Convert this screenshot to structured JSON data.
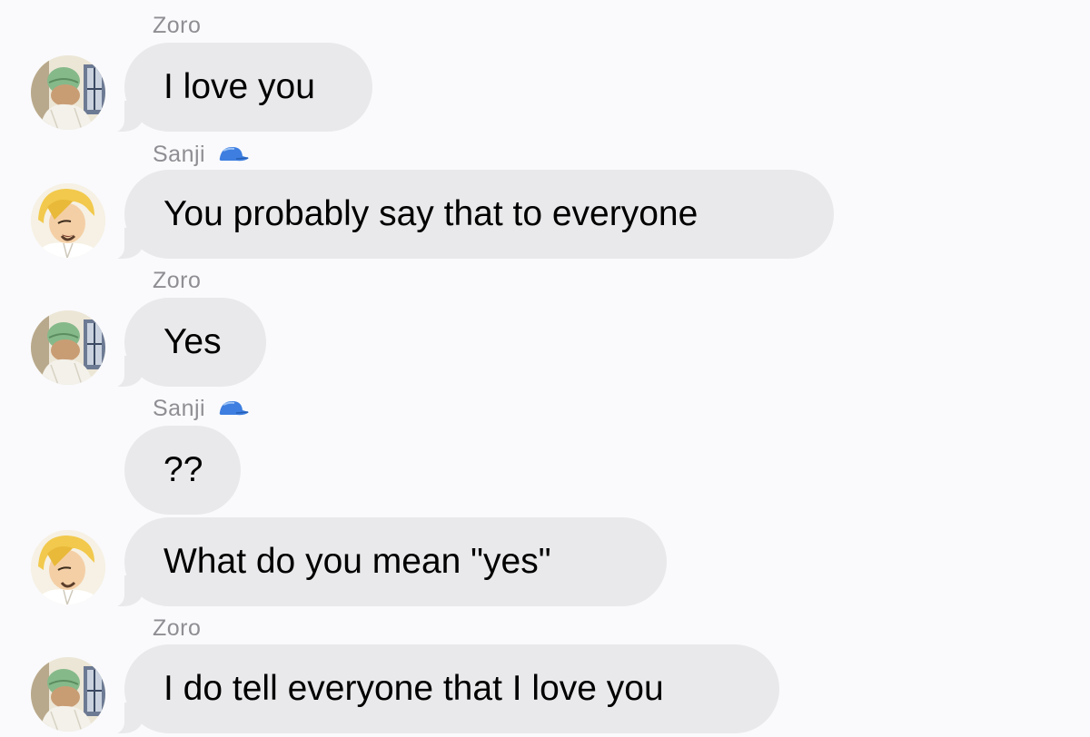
{
  "conversation": {
    "messages": [
      {
        "sender": "Zoro",
        "text": "I love you",
        "avatar_icon": "zoro-avatar-icon"
      },
      {
        "sender": "Sanji",
        "text": "You probably say that to everyone",
        "avatar_icon": "sanji-avatar-icon",
        "sender_badge_icon": "blue-cap-icon"
      },
      {
        "sender": "Zoro",
        "text": "Yes",
        "avatar_icon": "zoro-avatar-icon"
      },
      {
        "sender": "Sanji",
        "text": "??",
        "sender_badge_icon": "blue-cap-icon"
      },
      {
        "text": "What do you mean \"yes\"",
        "avatar_icon": "sanji-avatar-icon"
      },
      {
        "sender": "Zoro",
        "text": "I do tell everyone that I love you",
        "avatar_icon": "zoro-avatar-icon"
      }
    ]
  },
  "colors": {
    "background": "#fafafc",
    "incoming_bubble": "#e9e9eb",
    "sender_name": "#8e8e93",
    "badge_blue": "#3d7ee0"
  }
}
